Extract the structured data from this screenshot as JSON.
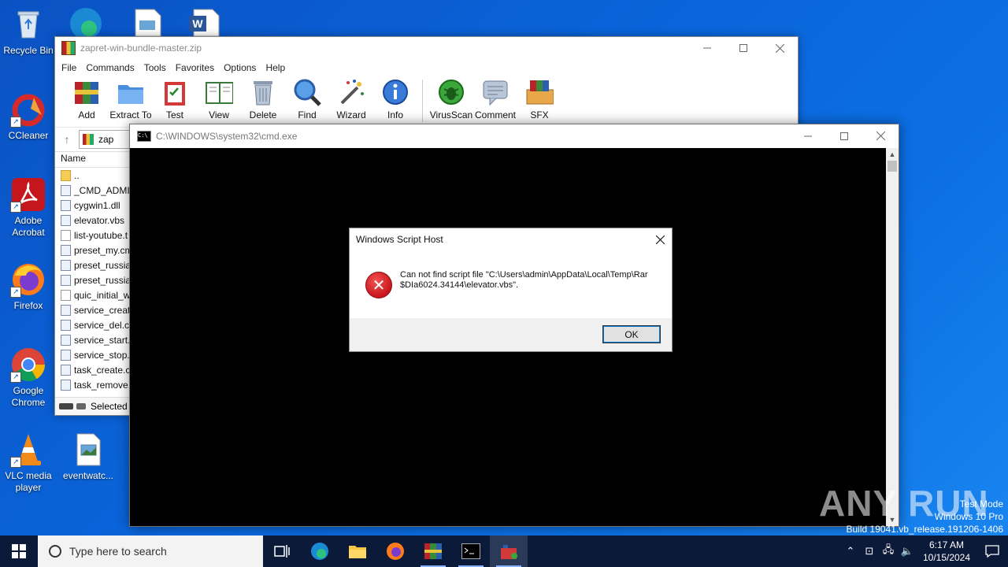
{
  "desktop": {
    "icons": [
      {
        "label": "Recycle Bin"
      },
      {
        "label": "CCleaner"
      },
      {
        "label": "Adobe Acrobat"
      },
      {
        "label": "Firefox"
      },
      {
        "label": "Google Chrome"
      },
      {
        "label": "VLC media player"
      },
      {
        "label": "eventwatc..."
      }
    ]
  },
  "winrar": {
    "title": "zapret-win-bundle-master.zip",
    "menu": [
      "File",
      "Commands",
      "Tools",
      "Favorites",
      "Options",
      "Help"
    ],
    "toolbar": [
      "Add",
      "Extract To",
      "Test",
      "View",
      "Delete",
      "Find",
      "Wizard",
      "Info",
      "VirusScan",
      "Comment",
      "SFX"
    ],
    "address": "zap",
    "column_name": "Name",
    "files": [
      "..",
      "_CMD_ADMIN",
      "cygwin1.dll",
      "elevator.vbs",
      "list-youtube.t",
      "preset_my.cm",
      "preset_russia.",
      "preset_russia_",
      "quic_initial_w",
      "service_create",
      "service_del.cr",
      "service_start.c",
      "service_stop.c",
      "task_create.cr",
      "task_remove."
    ],
    "status": "Selected"
  },
  "cmd": {
    "title": "C:\\WINDOWS\\system32\\cmd.exe",
    "icon_text": "C:\\"
  },
  "dialog": {
    "title": "Windows Script Host",
    "message": "Can not find script file \"C:\\Users\\admin\\AppData\\Local\\Temp\\Rar$DIa6024.34144\\elevator.vbs\".",
    "ok": "OK"
  },
  "watermark": {
    "brand": "ANY RUN",
    "line1": "Test Mode",
    "line2": "Windows 10 Pro",
    "line3": "Build 19041.vb_release.191206-1406"
  },
  "taskbar": {
    "search_placeholder": "Type here to search",
    "time": "6:17 AM",
    "date": "10/15/2024"
  }
}
